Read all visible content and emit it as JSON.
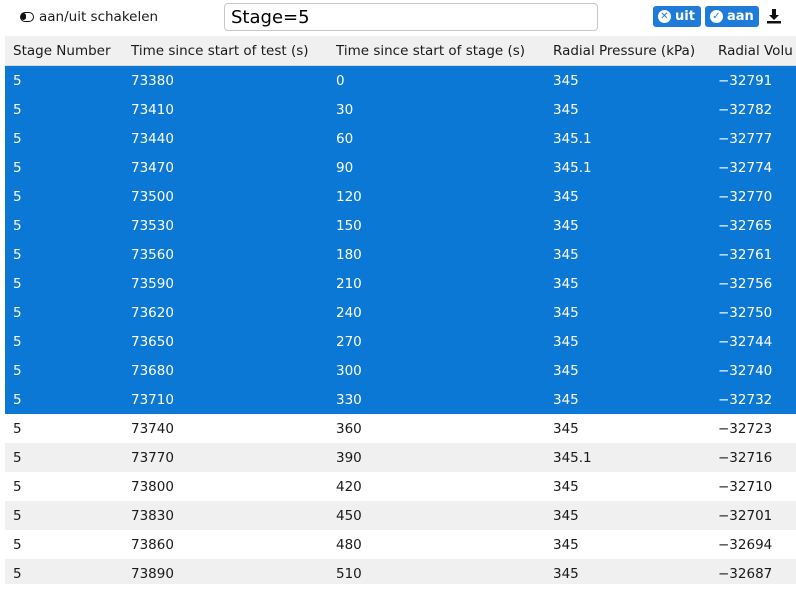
{
  "toolbar": {
    "toggle_label": "aan/uit schakelen",
    "filter_value": "Stage=5",
    "off_button_label": "uit",
    "on_button_label": "aan"
  },
  "table": {
    "columns": [
      "Stage Number",
      "Time since start of test (s)",
      "Time since start of stage (s)",
      "Radial Pressure (kPa)",
      "Radial Volu"
    ],
    "rows": [
      {
        "selected": true,
        "cells": [
          "5",
          "73380",
          "0",
          "345",
          "−32791"
        ]
      },
      {
        "selected": true,
        "cells": [
          "5",
          "73410",
          "30",
          "345",
          "−32782"
        ]
      },
      {
        "selected": true,
        "cells": [
          "5",
          "73440",
          "60",
          "345.1",
          "−32777"
        ]
      },
      {
        "selected": true,
        "cells": [
          "5",
          "73470",
          "90",
          "345.1",
          "−32774"
        ]
      },
      {
        "selected": true,
        "cells": [
          "5",
          "73500",
          "120",
          "345",
          "−32770"
        ]
      },
      {
        "selected": true,
        "cells": [
          "5",
          "73530",
          "150",
          "345",
          "−32765"
        ]
      },
      {
        "selected": true,
        "cells": [
          "5",
          "73560",
          "180",
          "345",
          "−32761"
        ]
      },
      {
        "selected": true,
        "cells": [
          "5",
          "73590",
          "210",
          "345",
          "−32756"
        ]
      },
      {
        "selected": true,
        "cells": [
          "5",
          "73620",
          "240",
          "345",
          "−32750"
        ]
      },
      {
        "selected": true,
        "cells": [
          "5",
          "73650",
          "270",
          "345",
          "−32744"
        ]
      },
      {
        "selected": true,
        "cells": [
          "5",
          "73680",
          "300",
          "345",
          "−32740"
        ]
      },
      {
        "selected": true,
        "cells": [
          "5",
          "73710",
          "330",
          "345",
          "−32732"
        ]
      },
      {
        "selected": false,
        "cells": [
          "5",
          "73740",
          "360",
          "345",
          "−32723"
        ]
      },
      {
        "selected": false,
        "cells": [
          "5",
          "73770",
          "390",
          "345.1",
          "−32716"
        ]
      },
      {
        "selected": false,
        "cells": [
          "5",
          "73800",
          "420",
          "345",
          "−32710"
        ]
      },
      {
        "selected": false,
        "cells": [
          "5",
          "73830",
          "450",
          "345",
          "−32701"
        ]
      },
      {
        "selected": false,
        "cells": [
          "5",
          "73860",
          "480",
          "345",
          "−32694"
        ]
      },
      {
        "selected": false,
        "cells": [
          "5",
          "73890",
          "510",
          "345",
          "−32687"
        ]
      }
    ]
  },
  "colors": {
    "accent": "#1e7bd7",
    "selected_row": "#0b78d6",
    "striped_row": "#f0f0f0"
  }
}
